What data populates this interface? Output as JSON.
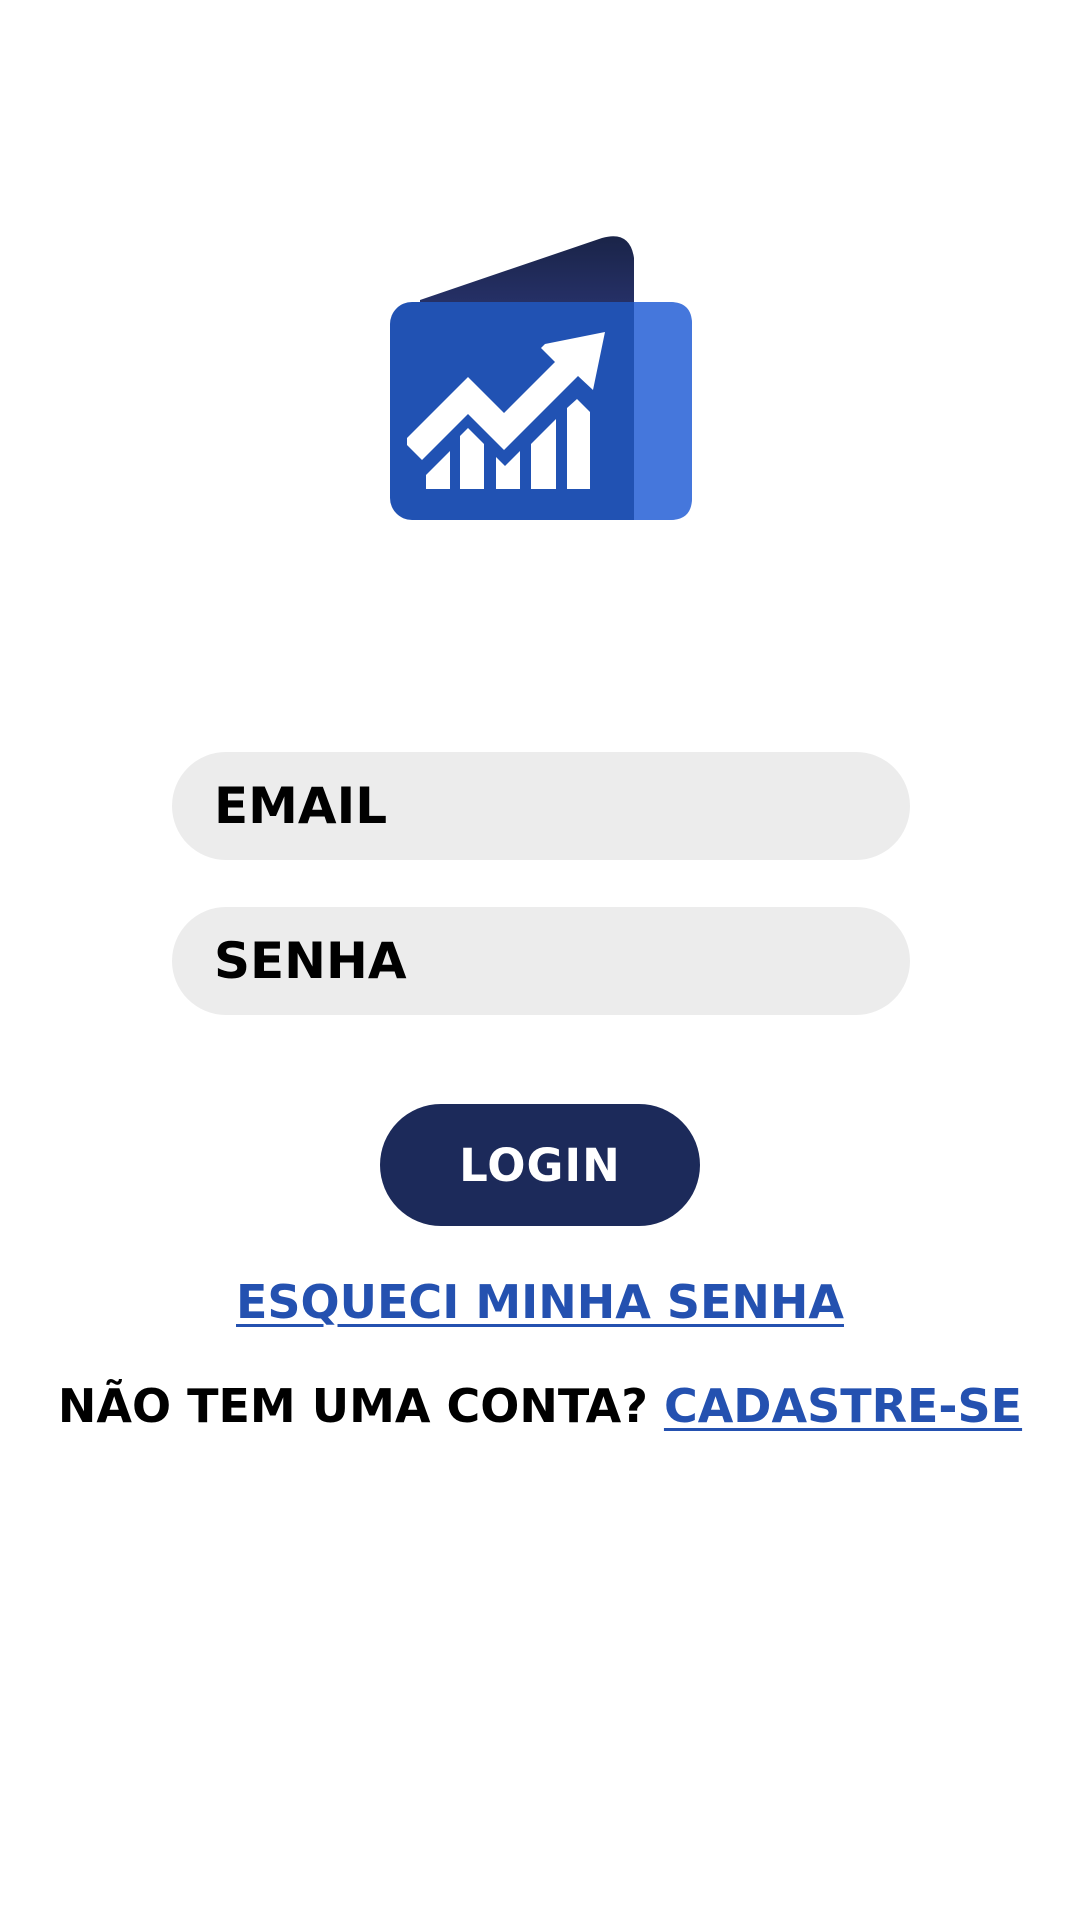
{
  "logo": {
    "icon": "wallet-growth-chart-icon",
    "colors": {
      "back_flap": "#1e2752",
      "body": "#2152b3",
      "side": "#4577dc",
      "chart": "#ffffff"
    }
  },
  "form": {
    "email_placeholder": "EMAIL",
    "password_placeholder": "SENHA",
    "login_label": "LOGIN"
  },
  "links": {
    "forgot_password": "ESQUECI MINHA SENHA",
    "no_account_prompt": "NÃO TEM UMA CONTA?",
    "signup": "CADASTRE-SE"
  },
  "colors": {
    "input_background": "#ececec",
    "button_background": "#1c2a5a",
    "link": "#2451b0",
    "text": "#000000"
  }
}
